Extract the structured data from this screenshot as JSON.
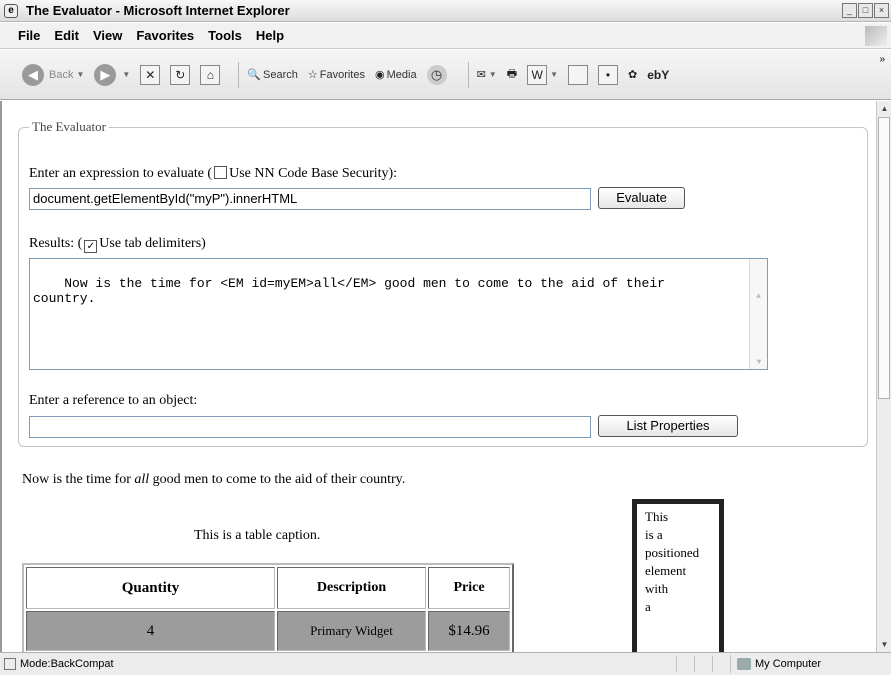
{
  "window": {
    "title": "The Evaluator - Microsoft Internet Explorer"
  },
  "menu": [
    "File",
    "Edit",
    "View",
    "Favorites",
    "Tools",
    "Help"
  ],
  "toolbar": {
    "back": "Back",
    "search": "Search",
    "favorites": "Favorites",
    "media": "Media"
  },
  "evaluator": {
    "legend": "The Evaluator",
    "expression_label_prefix": "Enter an expression to evaluate (",
    "security_label": "Use NN Code Base Security):",
    "security_checked": false,
    "expression_value": "document.getElementById(\"myP\").innerHTML",
    "evaluate_button": "Evaluate",
    "results_label_prefix": "Results: (",
    "tab_delimiters_label": "Use tab delimiters)",
    "tab_delimiters_checked": true,
    "results_text": "Now is the time for <EM id=myEM>all</EM> good men to come to the aid of their\ncountry.",
    "reference_label": "Enter a reference to an object:",
    "reference_value": "",
    "list_properties_button": "List Properties"
  },
  "content": {
    "paragraph_before": "Now is the time for ",
    "paragraph_em": "all",
    "paragraph_after": " good men to come to the aid of their country.",
    "table_caption": "This is a table caption.",
    "table_headers": [
      "Quantity",
      "Description",
      "Price"
    ],
    "table_row": [
      "4",
      "Primary Widget",
      "$14.96"
    ],
    "positioned_text": "This\nis a\npositioned\nelement\nwith\na"
  },
  "status": {
    "mode": "Mode:BackCompat",
    "zone": "My Computer"
  }
}
